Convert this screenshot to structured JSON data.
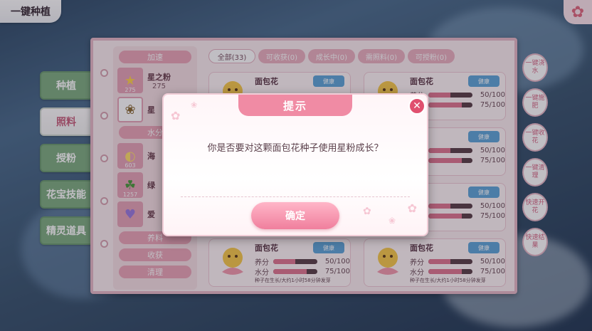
{
  "header": {
    "title": "一键种植",
    "corner_icon": "butterfly-icon"
  },
  "side_tabs": [
    {
      "label": "种植",
      "state": "active"
    },
    {
      "label": "照料",
      "state": "normal"
    },
    {
      "label": "授粉",
      "state": "green"
    },
    {
      "label": "花宝技能",
      "state": "green"
    },
    {
      "label": "精灵道具",
      "state": "green"
    }
  ],
  "left_column": {
    "header": "加速",
    "items": [
      {
        "name": "星之粉",
        "count": "275",
        "badge": "275"
      },
      {
        "name": "星",
        "count": "",
        "badge": ""
      },
      {
        "name": "海",
        "count": "",
        "badge": "603"
      },
      {
        "name": "绿",
        "count": "",
        "badge": "1257"
      },
      {
        "name": "爱",
        "count": "",
        "badge": ""
      }
    ],
    "section2": "水分",
    "buttons": [
      "养料",
      "收获",
      "清理"
    ]
  },
  "filters": [
    "全部(33)",
    "可收获(0)",
    "成长中(0)",
    "需照料(0)",
    "可授粉(0)"
  ],
  "cards": [
    {
      "name": "面包花",
      "button": "健康",
      "stat1_label": "养分",
      "stat1_val": "50/100",
      "stat1_pct": 50,
      "stat2_label": "水分",
      "stat2_val": "75/100",
      "stat2_pct": 75,
      "note": "种子在生长/大约1小时58分钟发芽"
    }
  ],
  "quick_buttons": [
    "一键浇水",
    "一键施肥",
    "一键收花",
    "一键清理",
    "快速开花",
    "快速结果"
  ],
  "dialog": {
    "title": "提示",
    "message": "你是否要对这颗面包花种子使用星粉成长？",
    "confirm": "确定"
  }
}
